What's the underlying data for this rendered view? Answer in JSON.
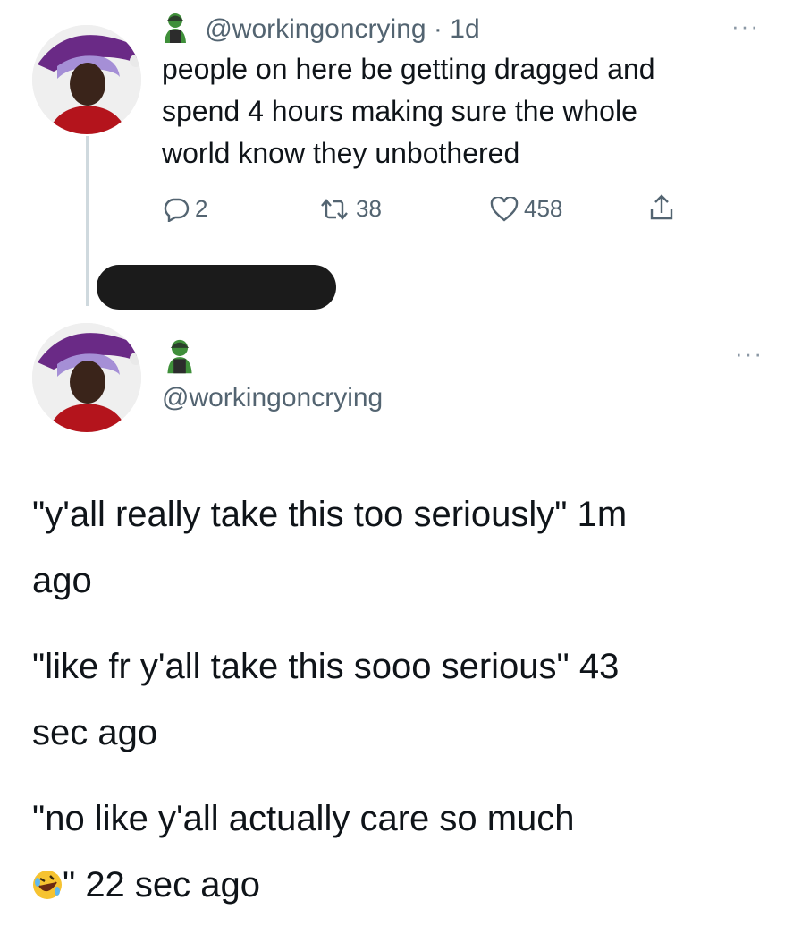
{
  "tweet": {
    "handle": "@workingoncrying",
    "separator": "·",
    "time": "1d",
    "more": "···",
    "text_lines": [
      "people on here be getting dragged and",
      "spend 4 hours making sure the whole",
      "world know they unbothered"
    ],
    "actions": {
      "replies": "2",
      "retweets": "38",
      "likes": "458"
    }
  },
  "reply": {
    "handle": "@workingoncrying",
    "more": "···"
  },
  "quotes": [
    {
      "line1": "\"y'all really take this too seriously\" 1m",
      "line2": "ago"
    },
    {
      "line1": "\"like fr y'all take this sooo serious\" 43",
      "line2": "sec ago"
    },
    {
      "line1": "\"no like y'all actually care so much",
      "line2": "\" 22 sec ago"
    }
  ],
  "icons": {
    "reply": "reply-icon",
    "retweet": "retweet-icon",
    "like": "heart-icon",
    "share": "share-icon",
    "emoji": "rolling-on-floor-laughing-emoji",
    "badge": "zombie-emoji"
  },
  "colors": {
    "handle_gray": "#536471",
    "redaction": "#1b1b1b",
    "hat_purple": "#6a2a86",
    "shirt_red": "#b4141c"
  }
}
